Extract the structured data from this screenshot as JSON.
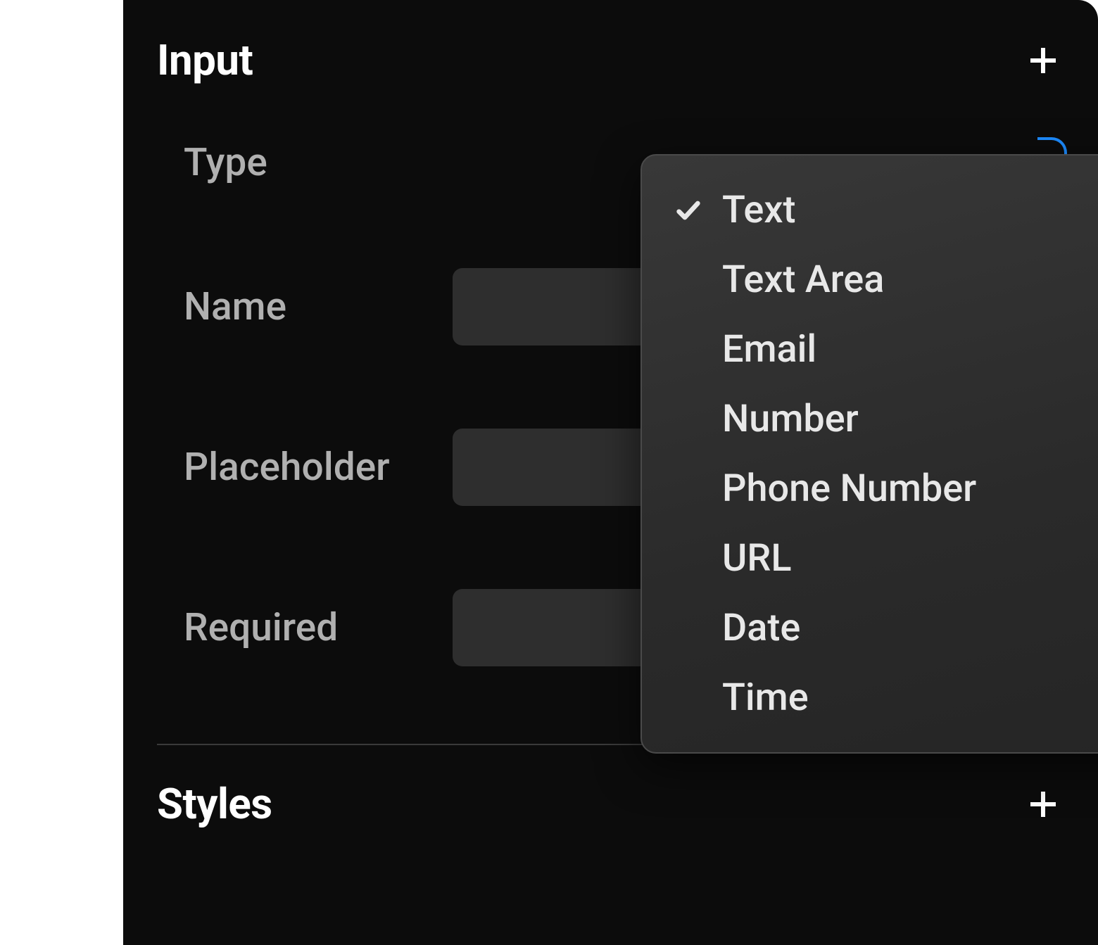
{
  "sections": {
    "input": {
      "title": "Input",
      "fields": {
        "type": {
          "label": "Type"
        },
        "name": {
          "label": "Name"
        },
        "placeholder": {
          "label": "Placeholder"
        },
        "required": {
          "label": "Required"
        }
      }
    },
    "styles": {
      "title": "Styles"
    }
  },
  "dropdown": {
    "selected": "Text",
    "options": [
      "Text",
      "Text Area",
      "Email",
      "Number",
      "Phone Number",
      "URL",
      "Date",
      "Time"
    ]
  }
}
